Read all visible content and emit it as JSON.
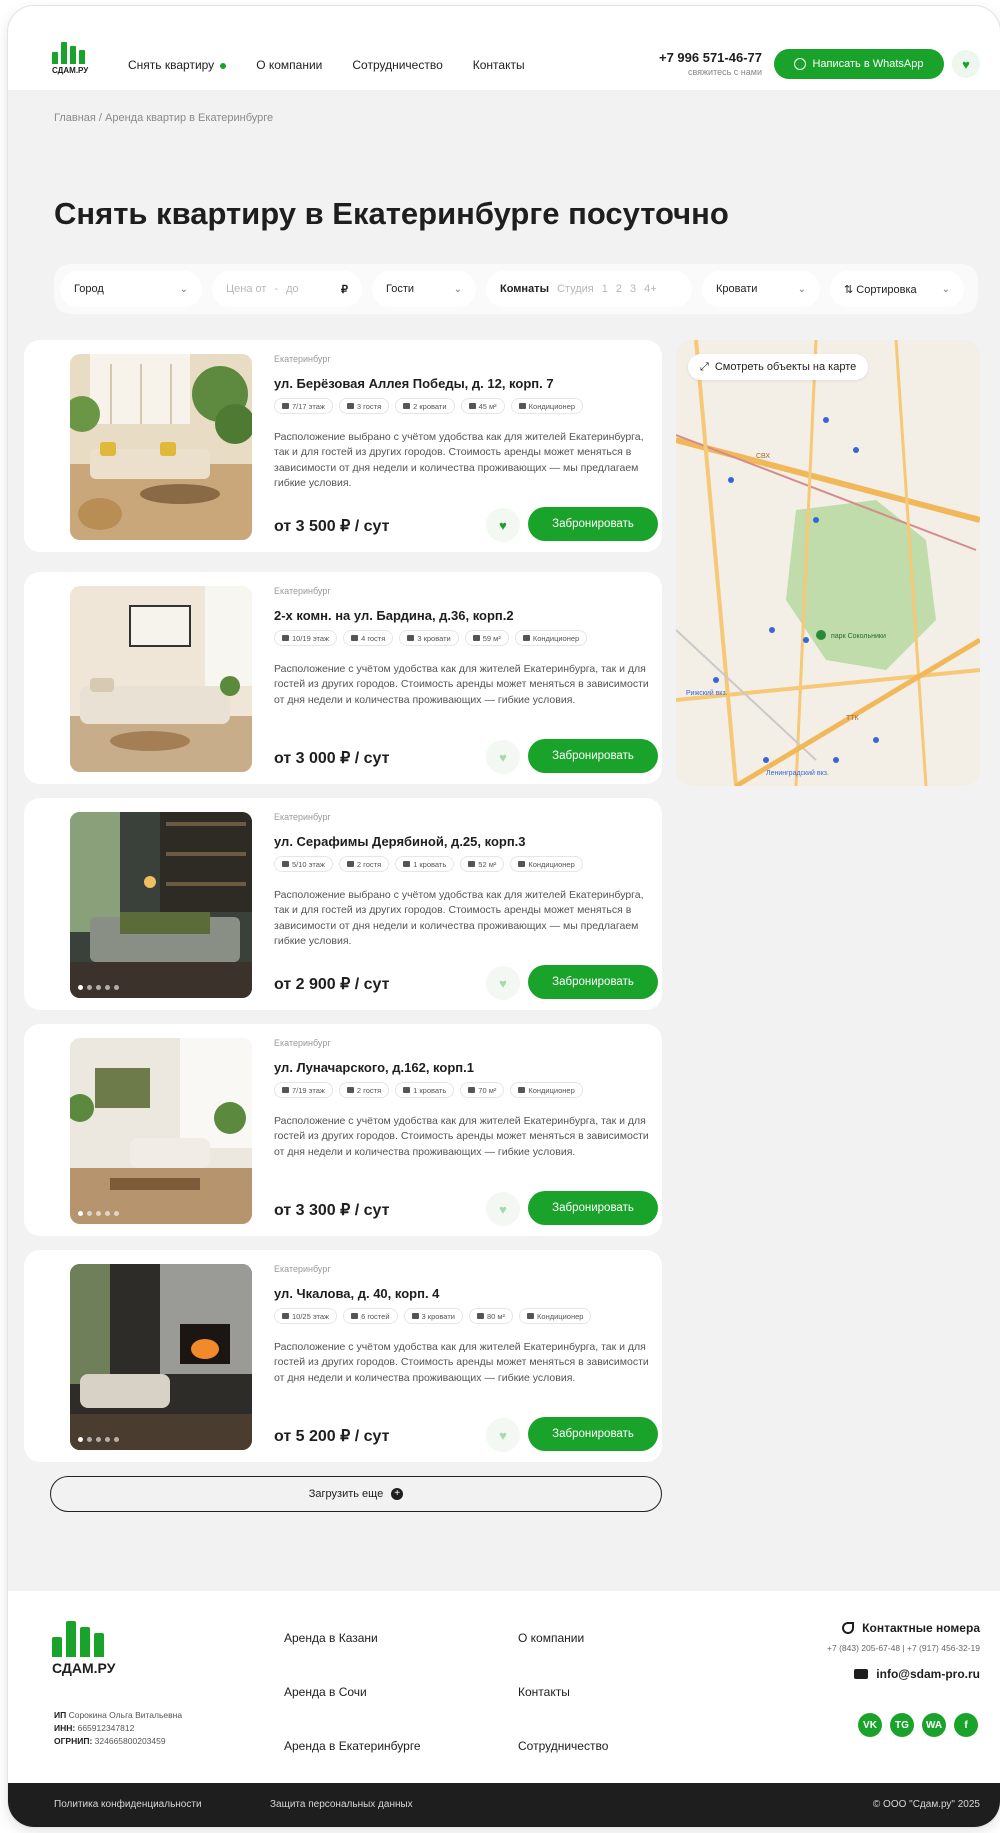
{
  "brand": {
    "name": "СДАМ.РУ",
    "green": "#1aa32a",
    "dark": "#1e1e1e"
  },
  "nav": [
    {
      "label": "Снять квартиру"
    },
    {
      "label": "О компании"
    },
    {
      "label": "Сотрудничество"
    },
    {
      "label": "Контакты"
    }
  ],
  "header": {
    "phone": "+7 996 571-46-77",
    "phone_sub": "свяжитесь с нами",
    "whatsapp": "Написать в WhatsApp"
  },
  "breadcrumb": "Главная / Аренда квартир в Екатеринбурге",
  "title": "Снять квартиру в Екатеринбурге посуточно",
  "filters": {
    "city": "Город",
    "price_from": "Цена от",
    "price_to": "до",
    "currency": "₽",
    "guests": "Гости",
    "rooms_label": "Комнаты",
    "rooms_options": [
      "Студия",
      "1",
      "2",
      "3",
      "4+"
    ],
    "beds": "Кровати",
    "sort": "⇅ Сортировка"
  },
  "listings": [
    {
      "city": "Екатеринбург",
      "address": "ул. Берёзовая Аллея Победы, д. 12, корп. 7",
      "chips": [
        "7/17 этаж",
        "3 гостя",
        "2 кровати",
        "45 м²",
        "Кондиционер"
      ],
      "description": "Расположение выбрано с учётом удобства как для жителей Екатеринбурга, так и для гостей из других городов. Стоимость аренды может меняться в зависимости от дня недели и количества проживающих — мы предлагаем гибкие условия.",
      "price": "от 3 500 ₽ / сут",
      "favorited": true,
      "book": "Забронировать"
    },
    {
      "city": "Екатеринбург",
      "address": "2-х комн. на ул. Бардина, д.36, корп.2",
      "chips": [
        "10/19 этаж",
        "4 гостя",
        "3 кровати",
        "59 м²",
        "Кондиционер"
      ],
      "description": "Расположение с учётом удобства как для жителей Екатеринбурга, так и для гостей из других городов. Стоимость аренды может меняться в зависимости от дня недели и количества проживающих — гибкие условия.",
      "price": "от 3 000 ₽ / сут",
      "favorited": false,
      "book": "Забронировать"
    },
    {
      "city": "Екатеринбург",
      "address": "ул. Серафимы Дерябиной, д.25, корп.3",
      "chips": [
        "5/10 этаж",
        "2 гостя",
        "1 кровать",
        "52 м²",
        "Кондиционер"
      ],
      "description": "Расположение выбрано с учётом удобства как для жителей Екатеринбурга, так и для гостей из других городов. Стоимость аренды может меняться в зависимости от дня недели и количества проживающих — мы предлагаем гибкие условия.",
      "price": "от 2 900 ₽ / сут",
      "favorited": false,
      "book": "Забронировать"
    },
    {
      "city": "Екатеринбург",
      "address": "ул. Луначарского, д.162, корп.1",
      "chips": [
        "7/19 этаж",
        "2 гостя",
        "1 кровать",
        "70 м²",
        "Кондиционер"
      ],
      "description": "Расположение с учётом удобства как для жителей Екатеринбурга, так и для гостей из других городов. Стоимость аренды может меняться в зависимости от дня недели и количества проживающих — гибкие условия.",
      "price": "от 3 300 ₽ / сут",
      "favorited": false,
      "book": "Забронировать"
    },
    {
      "city": "Екатеринбург",
      "address": "ул. Чкалова, д. 40, корп. 4",
      "chips": [
        "10/25 этаж",
        "6 гостей",
        "3 кровати",
        "80 м²",
        "Кондиционер"
      ],
      "description": "Расположение с учётом удобства как для жителей Екатеринбурга, так и для гостей из других городов. Стоимость аренды может меняться в зависимости от дня недели и количества проживающих — гибкие условия.",
      "price": "от 5 200 ₽ / сут",
      "favorited": false,
      "book": "Забронировать"
    }
  ],
  "map": {
    "button": "Смотреть объекты на карте",
    "labels": [
      "парк Сокольники",
      "Рижский вкз.",
      "Ленинградский вкз.",
      "СВХ",
      "ТТК"
    ]
  },
  "load_more": "Загрузить еще",
  "footer": {
    "logo": "СДАМ.РУ",
    "col1": [
      "Аренда в Казани",
      "Аренда в Сочи",
      "Аренда в Екатеринбурге"
    ],
    "col2": [
      "О компании",
      "Контакты",
      "Сотрудничество"
    ],
    "contacts_title": "Контактные номера",
    "phones": "+7 (843) 205-67-48   |   +7 (917) 456-32-19",
    "email": "info@sdam-pro.ru",
    "legal_ip_label": "ИП",
    "legal_ip": "Сорокина Ольга Витальевна",
    "legal_inn_label": "ИНН:",
    "legal_inn": "665912347812",
    "legal_ogrn_label": "ОГРНИП:",
    "legal_ogrn": "324665800203459",
    "socials": [
      "VK",
      "TG",
      "WA",
      "f"
    ]
  },
  "bottom": {
    "privacy": "Политика конфиденциальности",
    "data": "Защита персональных данных",
    "copyright": "© ООО \"Сдам.ру\" 2025"
  }
}
